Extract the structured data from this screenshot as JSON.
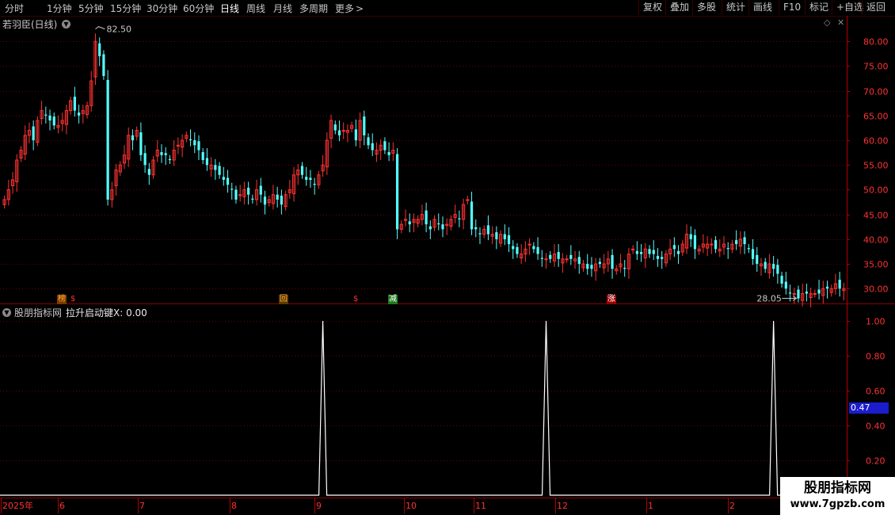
{
  "toolbar": {
    "periods": [
      "分时",
      "1分钟",
      "5分钟",
      "15分钟",
      "30分钟",
      "60分钟",
      "日线",
      "周线",
      "月线",
      "多周期",
      "更多"
    ],
    "active_period": "日线",
    "more_chevron": "chevron-right-icon",
    "buttons": [
      "复权",
      "叠加",
      "多股",
      "统计",
      "画线",
      "F10",
      "标记",
      "+自选",
      "返回"
    ]
  },
  "main_chart": {
    "title": "若羽臣(日线)",
    "high_label": "82.50",
    "low_label": "28.05"
  },
  "indicator": {
    "title": "股朋指标网",
    "formula": "拉升启动键X: 0.00",
    "current_value": "0.47"
  },
  "markers": [
    {
      "text": "榜",
      "color": "#ffaa33",
      "bg": "#7a3a00"
    },
    {
      "text": "$",
      "color": "#ff3030",
      "bg": ""
    },
    {
      "text": "回",
      "color": "#ffaa33",
      "bg": "#5a3a00"
    },
    {
      "text": "$",
      "color": "#ff3030",
      "bg": ""
    },
    {
      "text": "减",
      "color": "#ffffff",
      "bg": "#1f7a1f"
    },
    {
      "text": "涨",
      "color": "#ffffff",
      "bg": "#9a0000"
    }
  ],
  "time_axis": [
    "2025年",
    "6",
    "7",
    "8",
    "9",
    "10",
    "11",
    "12",
    "1",
    "2"
  ],
  "watermark": {
    "line1": "股朋指标网",
    "line2": "www.7gpzb.com"
  },
  "colors": {
    "up": "#ff3232",
    "down": "#54ffff",
    "grid": "#6a0000",
    "axis": "#ff3232"
  },
  "chart_data": [
    {
      "type": "candlestick",
      "title": "若羽臣(日线)",
      "y_ticks": [
        "80.00",
        "75.00",
        "70.00",
        "65.00",
        "60.00",
        "55.00",
        "50.00",
        "45.00",
        "40.00",
        "35.00",
        "30.00"
      ],
      "ylim": [
        27,
        85
      ],
      "x_month_labels": [
        "2025年",
        "6",
        "7",
        "8",
        "9",
        "10",
        "11",
        "12",
        "1",
        "2"
      ],
      "close": [
        48,
        50,
        52,
        56,
        58,
        61,
        62,
        60,
        64,
        66,
        65,
        64,
        63,
        63,
        64,
        66,
        68,
        66,
        65,
        66,
        67,
        72,
        80,
        77,
        73,
        48,
        50,
        54,
        55,
        57,
        61,
        60,
        62,
        57,
        55,
        53,
        56,
        58,
        57,
        57,
        56,
        58,
        59,
        60,
        61,
        60,
        59,
        58,
        56,
        55,
        55,
        54,
        53,
        52,
        51,
        50,
        48,
        49,
        50,
        49,
        48,
        50,
        49,
        47,
        48,
        49,
        48,
        47,
        49,
        50,
        53,
        54,
        53,
        52,
        52,
        51,
        53,
        55,
        60,
        64,
        62,
        61,
        62,
        62,
        63,
        60,
        64,
        61,
        59,
        58,
        58,
        59,
        58,
        57,
        58,
        42,
        43,
        44,
        43,
        44,
        44,
        45,
        43,
        42,
        44,
        43,
        42,
        43,
        44,
        45,
        44,
        47,
        48,
        42,
        42,
        41,
        42,
        41,
        41,
        40,
        41,
        40,
        39,
        38,
        37,
        37,
        38,
        39,
        38,
        37,
        36,
        36,
        36,
        37,
        36,
        36,
        36,
        36,
        36,
        35,
        35,
        34,
        34,
        35,
        35,
        35,
        36,
        34,
        34,
        35,
        34,
        37,
        38,
        37,
        37,
        38,
        37,
        37,
        36,
        36,
        37,
        38,
        38,
        37,
        39,
        41,
        40,
        38,
        38,
        39,
        39,
        39,
        38,
        38,
        39,
        38,
        39,
        39,
        40,
        39,
        38,
        36,
        35,
        35,
        34,
        35,
        34,
        33,
        31,
        30,
        29,
        29,
        28,
        29,
        29,
        29,
        29,
        29,
        30,
        30,
        30,
        31,
        30,
        30
      ]
    },
    {
      "type": "line",
      "name": "拉升启动键X",
      "y_ticks": [
        "1.00",
        "0.80",
        "0.60",
        "0.40",
        "0.20"
      ],
      "ylim": [
        0,
        1.05
      ],
      "spikes_at_index": [
        77,
        131,
        186
      ],
      "spike_value": 1.0,
      "baseline": 0.0
    }
  ]
}
